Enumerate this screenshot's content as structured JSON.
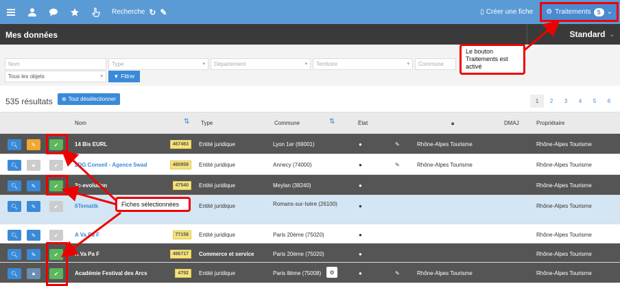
{
  "nav": {
    "search_label": "Recherche",
    "create_label": "Créer une fiche",
    "traitements_label": "Traitements",
    "traitements_count": "5"
  },
  "header": {
    "title": "Mes données",
    "view": "Standard"
  },
  "filters": {
    "nom": "Nom",
    "type": "Type",
    "departement": "Département",
    "territoire": "Territoire",
    "commune": "Commune",
    "objets": "Tous les objets",
    "filter_button": "Filtrer"
  },
  "results": {
    "count": "535 résultats",
    "deselect": "Tout désélectionner"
  },
  "pager": [
    "1",
    "2",
    "3",
    "4",
    "5",
    "6"
  ],
  "columns": {
    "nom": "Nom",
    "type": "Type",
    "commune": "Commune",
    "etat": "État",
    "dmaj": "DMAJ",
    "proprietaire": "Propriétaire"
  },
  "rows": [
    {
      "name": "14 Bis EURL",
      "id": "467463",
      "type": "Entité juridique",
      "commune": "Lyon 1er (69001)",
      "lock": "Rhône-Alpes Tourisme",
      "owner": "Rhône-Alpes Tourisme"
    },
    {
      "name": "2DG Conseil - Agence 5wad",
      "id": "480959",
      "type": "Entité juridique",
      "commune": "Annecy (74000)",
      "lock": "Rhône-Alpes Tourisme",
      "owner": "Rhône-Alpes Tourisme"
    },
    {
      "name": "3c-evolution",
      "id": "47540",
      "type": "Entité juridique",
      "commune": "Meylan (38240)",
      "lock": "",
      "owner": "Rhône-Alpes Tourisme"
    },
    {
      "name": "6Tematik",
      "id": "",
      "type": "Entité juridique",
      "commune": "Romans-sur-Isère (26100)",
      "lock": "",
      "owner": "Rhône-Alpes Tourisme"
    },
    {
      "name": "A Va Pa F",
      "id": "77158",
      "type": "Entité juridique",
      "commune": "Paris 20ème (75020)",
      "lock": "",
      "owner": "Rhône-Alpes Tourisme"
    },
    {
      "name": "A Va Pa F",
      "id": "486717",
      "type": "Commerce et service",
      "commune": "Paris 20ème (75020)",
      "lock": "",
      "owner": "Rhône-Alpes Tourisme"
    },
    {
      "name": "Académie Festival des Arcs",
      "id": "4792",
      "type": "Entité juridique",
      "commune": "Paris 8ème (75008)",
      "lock": "Rhône-Alpes Tourisme",
      "owner": "Rhône-Alpes Tourisme"
    }
  ],
  "callouts": {
    "traitements_note": "Le bouton Traitements est activé",
    "selected_note": "Fiches sélectionnées"
  },
  "colors": {
    "accent": "#5b9bd5",
    "highlight": "#e00000",
    "check_on": "#5cb85c"
  }
}
